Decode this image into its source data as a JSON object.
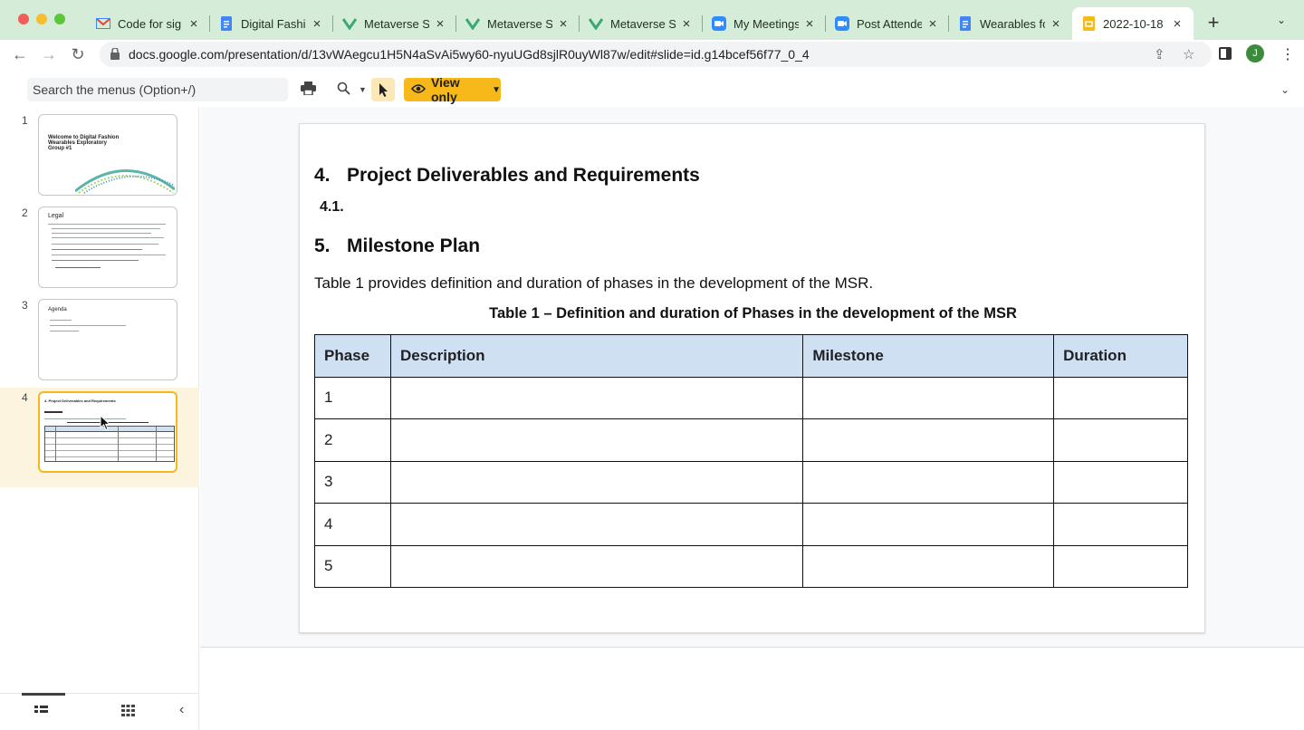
{
  "browser": {
    "tabs": [
      {
        "title": "Code for sig",
        "icon": "gmail-icon"
      },
      {
        "title": "Digital Fashi",
        "icon": "docs-icon"
      },
      {
        "title": "Metaverse S",
        "icon": "metaverse-icon"
      },
      {
        "title": "Metaverse S",
        "icon": "metaverse-icon"
      },
      {
        "title": "Metaverse S",
        "icon": "metaverse-icon"
      },
      {
        "title": "My Meetings",
        "icon": "zoom-icon"
      },
      {
        "title": "Post Attende",
        "icon": "zoom-icon"
      },
      {
        "title": "Wearables fo",
        "icon": "docs-icon"
      },
      {
        "title": "2022-10-18",
        "icon": "slides-icon",
        "active": true
      }
    ],
    "url": "docs.google.com/presentation/d/13vWAegcu1H5N4aSvAi5wy60-nyuUGd8sjlR0uyWl87w/edit#slide=id.g14bcef56f77_0_4",
    "avatar_letter": "J"
  },
  "toolbar": {
    "search_placeholder": "Search the menus (Option+/)",
    "view_mode": "View only"
  },
  "filmstrip": {
    "slides": [
      {
        "number": "1",
        "title": "Welcome to Digital Fashion Wearables Exploratory Group #1"
      },
      {
        "number": "2",
        "title": "Legal"
      },
      {
        "number": "3",
        "title": "Agenda"
      },
      {
        "number": "4",
        "title": "4. Project Deliverables and Requirements",
        "active": true
      }
    ]
  },
  "slide": {
    "heading1_num": "4.",
    "heading1_text": "Project Deliverables and Requirements",
    "sub_num": "4.1.",
    "heading2_num": "5.",
    "heading2_text": "Milestone Plan",
    "paragraph": "Table 1 provides definition and duration of phases in the development of the MSR.",
    "table_caption": "Table 1 – Definition and duration of Phases in the development of the MSR",
    "table": {
      "headers": [
        "Phase",
        "Description",
        "Milestone",
        "Duration"
      ],
      "rows": [
        [
          "1",
          "",
          "",
          ""
        ],
        [
          "2",
          "",
          "",
          ""
        ],
        [
          "3",
          "",
          "",
          ""
        ],
        [
          "4",
          "",
          "",
          ""
        ],
        [
          "5",
          "",
          "",
          ""
        ]
      ]
    }
  },
  "colors": {
    "tabstrip": "#d4ecd8",
    "accent": "#f6b919",
    "table_header": "#cfe0f3"
  }
}
